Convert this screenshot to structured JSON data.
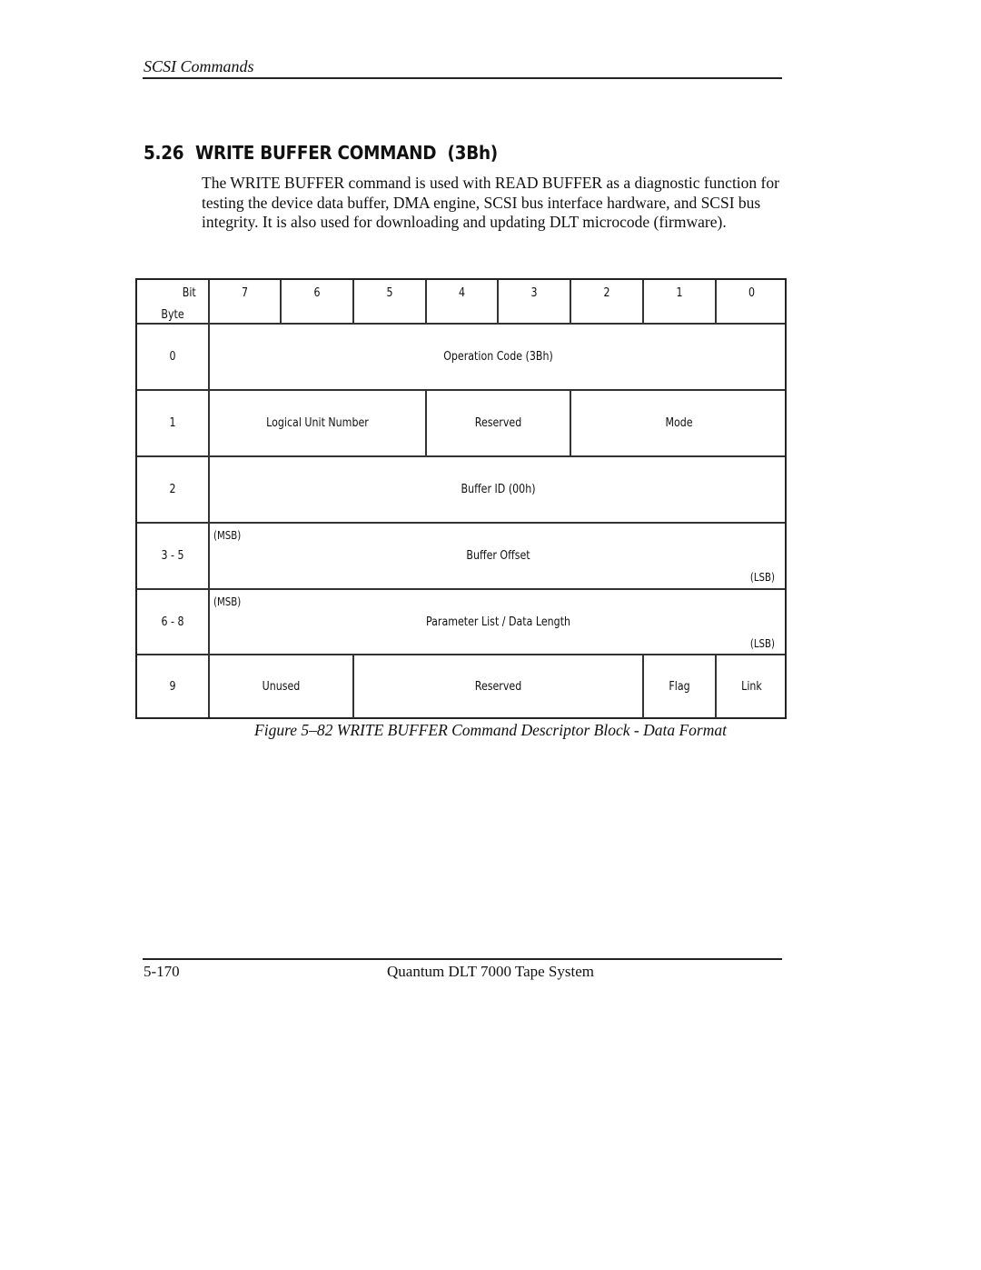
{
  "header": {
    "running_head": "SCSI Commands"
  },
  "section": {
    "number": "5.26",
    "title": "WRITE BUFFER COMMAND  (3Bh)"
  },
  "intro": "The WRITE BUFFER command is used with READ BUFFER as a diagnostic function for testing the device data buffer, DMA engine, SCSI bus interface hardware, and SCSI bus integrity. It is also used for downloading and updating DLT microcode (firmware).",
  "table": {
    "corner_bit": "Bit",
    "corner_byte": "Byte",
    "bits": [
      "7",
      "6",
      "5",
      "4",
      "3",
      "2",
      "1",
      "0"
    ],
    "rows": {
      "r0": {
        "byte": "0",
        "field": "Operation Code (3Bh)"
      },
      "r1": {
        "byte": "1",
        "lun": "Logical Unit Number",
        "reserved": "Reserved",
        "mode": "Mode"
      },
      "r2": {
        "byte": "2",
        "field": "Buffer ID (00h)"
      },
      "r3": {
        "byte": "3 - 5",
        "msb": "(MSB)",
        "field": "Buffer Offset",
        "lsb": "(LSB)"
      },
      "r4": {
        "byte": "6 - 8",
        "msb": "(MSB)",
        "field": "Parameter List / Data Length",
        "lsb": "(LSB)"
      },
      "r5": {
        "byte": "9",
        "unused": "Unused",
        "reserved": "Reserved",
        "flag": "Flag",
        "link": "Link"
      }
    }
  },
  "caption": "Figure 5–82  WRITE BUFFER Command Descriptor Block - Data Format",
  "footer": {
    "page_number": "5-170",
    "title": "Quantum DLT 7000 Tape System"
  }
}
